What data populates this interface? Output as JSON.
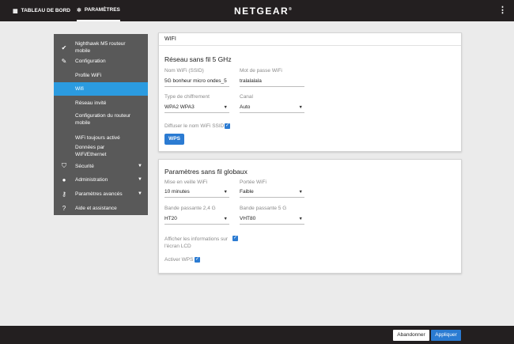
{
  "topbar": {
    "dashboard_label": "TABLEAU DE BORD",
    "settings_label": "PARAMÈTRES",
    "brand": "NETGEAR",
    "brand_mark": "®"
  },
  "sidebar": {
    "items": [
      {
        "label": "Nighthawk M5 routeur mobile",
        "icon": "check-circle-icon"
      },
      {
        "label": "Configuration",
        "icon": "wrench-icon"
      },
      {
        "label": "Profile WiFi"
      },
      {
        "label": "Wifi"
      },
      {
        "label": "Réseau invité"
      },
      {
        "label": "Configuration du routeur mobile"
      },
      {
        "label": "WiFi toujours activé"
      },
      {
        "label": "Données par WiFi/Ethernet"
      },
      {
        "label": "Sécurité",
        "icon": "shield-icon"
      },
      {
        "label": "Administration",
        "icon": "user-icon"
      },
      {
        "label": "Paramètres avancés",
        "icon": "key-icon"
      },
      {
        "label": "Aide et assistance",
        "icon": "help-icon"
      }
    ]
  },
  "wifi_card": {
    "header": "WIFI",
    "section_title": "Réseau sans fil 5 GHz",
    "ssid_label": "Nom WiFi (SSID)",
    "ssid_value": "5G bonheur micro ondes_5",
    "password_label": "Mot de passe WiFi",
    "password_value": "tralalalala",
    "encryption_label": "Type de chiffrement",
    "encryption_value": "WPA2 WPA3",
    "channel_label": "Canal",
    "channel_value": "Auto",
    "broadcast_label": "Diffuser le nom WiFi SSID",
    "wps_button": "WPS"
  },
  "global_card": {
    "section_title": "Paramètres sans fil globaux",
    "standby_label": "Mise en veille WiFi",
    "standby_value": "10 minutes",
    "range_label": "Portée WiFi",
    "range_value": "Faible",
    "bw24_label": "Bande passante 2,4 G",
    "bw24_value": "HT20",
    "bw5_label": "Bande passante 5 G",
    "bw5_value": "VHT80",
    "lcd_label": "Afficher les informations sur l'écran LCD",
    "wps_enable_label": "Activer WPS"
  },
  "footer": {
    "cancel_label": "Abandonner",
    "apply_label": "Appliquer"
  },
  "colors": {
    "topbar": "#231f20",
    "sidebar": "#595959",
    "active": "#2b9be0",
    "button": "#2b7bd2"
  }
}
